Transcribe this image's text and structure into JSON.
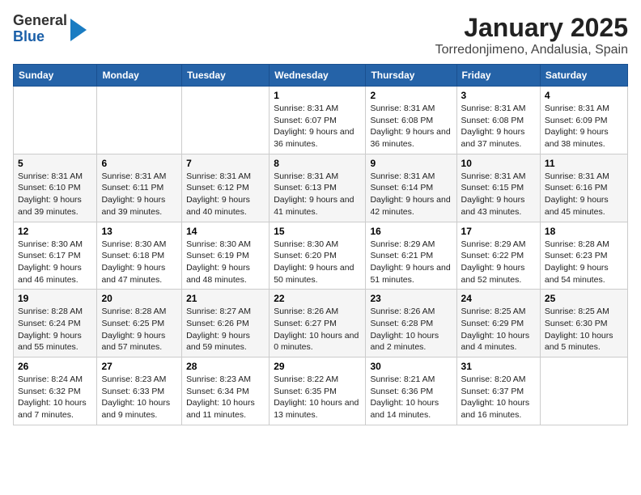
{
  "logo": {
    "general": "General",
    "blue": "Blue"
  },
  "title": "January 2025",
  "subtitle": "Torredonjimeno, Andalusia, Spain",
  "columns": [
    "Sunday",
    "Monday",
    "Tuesday",
    "Wednesday",
    "Thursday",
    "Friday",
    "Saturday"
  ],
  "weeks": [
    [
      {
        "day": "",
        "info": ""
      },
      {
        "day": "",
        "info": ""
      },
      {
        "day": "",
        "info": ""
      },
      {
        "day": "1",
        "info": "Sunrise: 8:31 AM\nSunset: 6:07 PM\nDaylight: 9 hours and 36 minutes."
      },
      {
        "day": "2",
        "info": "Sunrise: 8:31 AM\nSunset: 6:08 PM\nDaylight: 9 hours and 36 minutes."
      },
      {
        "day": "3",
        "info": "Sunrise: 8:31 AM\nSunset: 6:08 PM\nDaylight: 9 hours and 37 minutes."
      },
      {
        "day": "4",
        "info": "Sunrise: 8:31 AM\nSunset: 6:09 PM\nDaylight: 9 hours and 38 minutes."
      }
    ],
    [
      {
        "day": "5",
        "info": "Sunrise: 8:31 AM\nSunset: 6:10 PM\nDaylight: 9 hours and 39 minutes."
      },
      {
        "day": "6",
        "info": "Sunrise: 8:31 AM\nSunset: 6:11 PM\nDaylight: 9 hours and 39 minutes."
      },
      {
        "day": "7",
        "info": "Sunrise: 8:31 AM\nSunset: 6:12 PM\nDaylight: 9 hours and 40 minutes."
      },
      {
        "day": "8",
        "info": "Sunrise: 8:31 AM\nSunset: 6:13 PM\nDaylight: 9 hours and 41 minutes."
      },
      {
        "day": "9",
        "info": "Sunrise: 8:31 AM\nSunset: 6:14 PM\nDaylight: 9 hours and 42 minutes."
      },
      {
        "day": "10",
        "info": "Sunrise: 8:31 AM\nSunset: 6:15 PM\nDaylight: 9 hours and 43 minutes."
      },
      {
        "day": "11",
        "info": "Sunrise: 8:31 AM\nSunset: 6:16 PM\nDaylight: 9 hours and 45 minutes."
      }
    ],
    [
      {
        "day": "12",
        "info": "Sunrise: 8:30 AM\nSunset: 6:17 PM\nDaylight: 9 hours and 46 minutes."
      },
      {
        "day": "13",
        "info": "Sunrise: 8:30 AM\nSunset: 6:18 PM\nDaylight: 9 hours and 47 minutes."
      },
      {
        "day": "14",
        "info": "Sunrise: 8:30 AM\nSunset: 6:19 PM\nDaylight: 9 hours and 48 minutes."
      },
      {
        "day": "15",
        "info": "Sunrise: 8:30 AM\nSunset: 6:20 PM\nDaylight: 9 hours and 50 minutes."
      },
      {
        "day": "16",
        "info": "Sunrise: 8:29 AM\nSunset: 6:21 PM\nDaylight: 9 hours and 51 minutes."
      },
      {
        "day": "17",
        "info": "Sunrise: 8:29 AM\nSunset: 6:22 PM\nDaylight: 9 hours and 52 minutes."
      },
      {
        "day": "18",
        "info": "Sunrise: 8:28 AM\nSunset: 6:23 PM\nDaylight: 9 hours and 54 minutes."
      }
    ],
    [
      {
        "day": "19",
        "info": "Sunrise: 8:28 AM\nSunset: 6:24 PM\nDaylight: 9 hours and 55 minutes."
      },
      {
        "day": "20",
        "info": "Sunrise: 8:28 AM\nSunset: 6:25 PM\nDaylight: 9 hours and 57 minutes."
      },
      {
        "day": "21",
        "info": "Sunrise: 8:27 AM\nSunset: 6:26 PM\nDaylight: 9 hours and 59 minutes."
      },
      {
        "day": "22",
        "info": "Sunrise: 8:26 AM\nSunset: 6:27 PM\nDaylight: 10 hours and 0 minutes."
      },
      {
        "day": "23",
        "info": "Sunrise: 8:26 AM\nSunset: 6:28 PM\nDaylight: 10 hours and 2 minutes."
      },
      {
        "day": "24",
        "info": "Sunrise: 8:25 AM\nSunset: 6:29 PM\nDaylight: 10 hours and 4 minutes."
      },
      {
        "day": "25",
        "info": "Sunrise: 8:25 AM\nSunset: 6:30 PM\nDaylight: 10 hours and 5 minutes."
      }
    ],
    [
      {
        "day": "26",
        "info": "Sunrise: 8:24 AM\nSunset: 6:32 PM\nDaylight: 10 hours and 7 minutes."
      },
      {
        "day": "27",
        "info": "Sunrise: 8:23 AM\nSunset: 6:33 PM\nDaylight: 10 hours and 9 minutes."
      },
      {
        "day": "28",
        "info": "Sunrise: 8:23 AM\nSunset: 6:34 PM\nDaylight: 10 hours and 11 minutes."
      },
      {
        "day": "29",
        "info": "Sunrise: 8:22 AM\nSunset: 6:35 PM\nDaylight: 10 hours and 13 minutes."
      },
      {
        "day": "30",
        "info": "Sunrise: 8:21 AM\nSunset: 6:36 PM\nDaylight: 10 hours and 14 minutes."
      },
      {
        "day": "31",
        "info": "Sunrise: 8:20 AM\nSunset: 6:37 PM\nDaylight: 10 hours and 16 minutes."
      },
      {
        "day": "",
        "info": ""
      }
    ]
  ]
}
